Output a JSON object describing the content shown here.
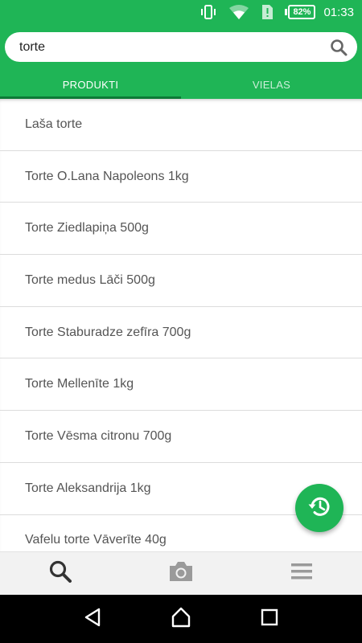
{
  "status_bar": {
    "battery": "82%",
    "time": "01:33",
    "icons": [
      "vibrate-icon",
      "wifi-icon",
      "sim-alert-icon",
      "battery-charging-icon"
    ]
  },
  "search": {
    "value": "torte",
    "icon": "search-icon"
  },
  "tabs": [
    {
      "label": "PRODUKTI",
      "active": true
    },
    {
      "label": "VIELAS",
      "active": false
    }
  ],
  "results": [
    "Laša torte",
    "Torte O.Lana Napoleons 1kg",
    "Torte Ziedlapiņa 500g",
    "Torte medus Lāči 500g",
    "Torte Staburadze zefīra 700g",
    "Torte Mellenīte 1kg",
    "Torte Vēsma citronu 700g",
    "Torte Aleksandrija 1kg",
    "Vafelu torte Vāverīte 40g"
  ],
  "fab": {
    "icon": "history-icon"
  },
  "bottom_nav": [
    "search-icon",
    "camera-icon",
    "menu-icon"
  ],
  "system_nav": [
    "back-icon",
    "home-icon",
    "recents-icon"
  ],
  "colors": {
    "brand_green": "#1fb556",
    "tab_indicator": "#0d7a37",
    "list_text": "#555555",
    "divider": "#dcdcdc"
  }
}
